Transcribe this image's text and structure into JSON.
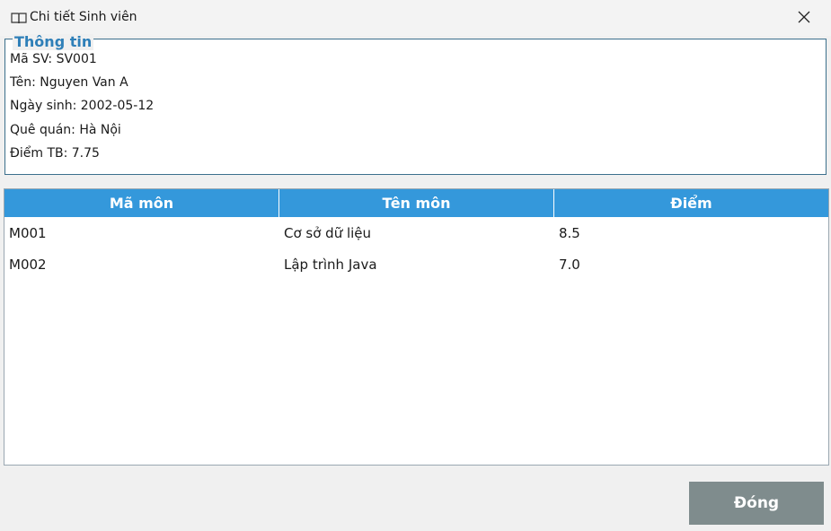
{
  "window": {
    "title": "Chi tiết Sinh viên",
    "title_icon": "book-icon",
    "close_icon": "close-icon"
  },
  "info": {
    "legend": "Thông tin",
    "student_id": "Mã SV: SV001",
    "name": "Tên: Nguyen Van A",
    "birthdate": "Ngày sinh: 2002-05-12",
    "hometown": "Quê quán: Hà Nội",
    "gpa": "Điểm TB: 7.75"
  },
  "table": {
    "headers": [
      "Mã môn",
      "Tên môn",
      "Điểm"
    ],
    "rows": [
      [
        "M001",
        "Cơ sở dữ liệu",
        "8.5"
      ],
      [
        "M002",
        "Lập trình Java",
        "7.0"
      ]
    ]
  },
  "actions": {
    "close_label": "Đóng"
  },
  "colors": {
    "header_bg": "#3498db",
    "legend_text": "#2e7fb8",
    "close_button_bg": "#7f8c8d"
  }
}
